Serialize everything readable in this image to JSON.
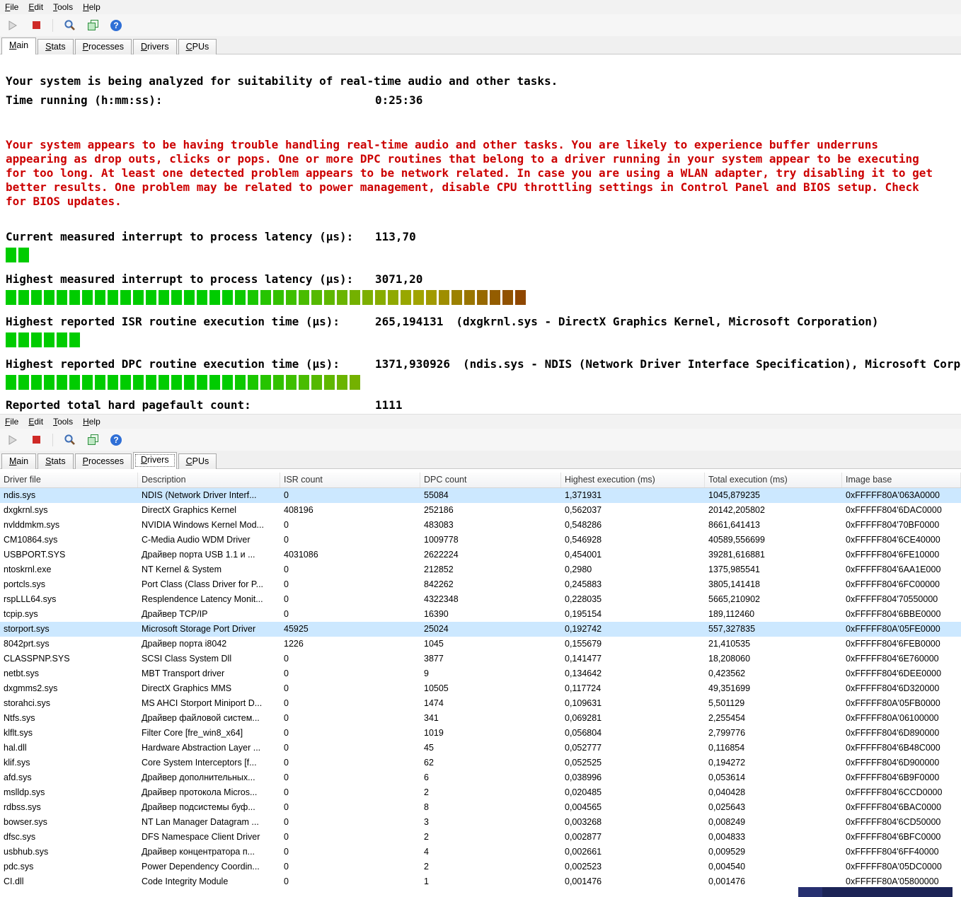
{
  "colors": {
    "warning_text": "#cc0000",
    "selection_row": "#cce8ff",
    "meter_green": "#00cc00",
    "meter_brown": "#8f4700",
    "stop_red": "#cf2a27",
    "artifact_navy": "#1c2456"
  },
  "menu": {
    "items": [
      "File",
      "Edit",
      "Tools",
      "Help"
    ]
  },
  "toolbar": {
    "buttons": [
      "play",
      "stop",
      "analyze",
      "report",
      "help"
    ]
  },
  "tabs": [
    "Main",
    "Stats",
    "Processes",
    "Drivers",
    "CPUs"
  ],
  "top_window": {
    "selected_tab": "Main",
    "analysis_line": "Your system is being analyzed for suitability of real-time audio and other tasks.",
    "time_label": "Time running (h:mm:ss):",
    "time_value": "0:25:36",
    "warning_lines": [
      "Your system appears to be having trouble handling real-time audio and other tasks. You are likely to experience buffer underruns",
      "appearing as drop outs, clicks or pops. One or more DPC routines that belong to a driver running in your system appear to be executing",
      "for too long. At least one detected problem appears to be network related. In case you are using a WLAN adapter, try disabling it to get",
      "better results. One problem may be related to power management, disable CPU throttling settings in Control Panel and BIOS setup. Check",
      "for BIOS updates."
    ],
    "meters": [
      {
        "label": "Current measured interrupt to process latency (µs):",
        "value": "113,70",
        "extra": "",
        "segments": 2
      },
      {
        "label": "Highest measured interrupt to process latency (µs):",
        "value": "3071,20",
        "extra": "",
        "segments": 41
      },
      {
        "label": "Highest reported ISR routine execution time (µs):",
        "value": "265,194131",
        "extra": "(dxgkrnl.sys - DirectX Graphics Kernel, Microsoft Corporation)",
        "segments": 6
      },
      {
        "label": "Highest reported DPC routine execution time (µs):",
        "value": "1371,930926",
        "extra": "(ndis.sys - NDIS (Network Driver Interface Specification), Microsoft Corporation)",
        "segments": 28
      }
    ],
    "pagefault_label": "Reported total hard pagefault count:",
    "pagefault_value": "1111"
  },
  "bottom_window": {
    "selected_tab": "Drivers",
    "table": {
      "columns": [
        "Driver file",
        "Description",
        "ISR count",
        "DPC count",
        "Highest execution (ms)",
        "Total execution (ms)",
        "Image base"
      ],
      "selected_row_indexes": [
        0,
        9
      ],
      "rows": [
        [
          "ndis.sys",
          "NDIS (Network Driver Interf...",
          "0",
          "55084",
          "1,371931",
          "1045,879235",
          "0xFFFFF80A'063A0000"
        ],
        [
          "dxgkrnl.sys",
          "DirectX Graphics Kernel",
          "408196",
          "252186",
          "0,562037",
          "20142,205802",
          "0xFFFFF804'6DAC0000"
        ],
        [
          "nvlddmkm.sys",
          "NVIDIA Windows Kernel Mod...",
          "0",
          "483083",
          "0,548286",
          "8661,641413",
          "0xFFFFF804'70BF0000"
        ],
        [
          "CM10864.sys",
          "C-Media Audio WDM Driver",
          "0",
          "1009778",
          "0,546928",
          "40589,556699",
          "0xFFFFF804'6CE40000"
        ],
        [
          "USBPORT.SYS",
          "Драйвер порта USB 1.1 и ...",
          "4031086",
          "2622224",
          "0,454001",
          "39281,616881",
          "0xFFFFF804'6FE10000"
        ],
        [
          "ntoskrnl.exe",
          "NT Kernel & System",
          "0",
          "212852",
          "0,2980",
          "1375,985541",
          "0xFFFFF804'6AA1E000"
        ],
        [
          "portcls.sys",
          "Port Class (Class Driver for P...",
          "0",
          "842262",
          "0,245883",
          "3805,141418",
          "0xFFFFF804'6FC00000"
        ],
        [
          "rspLLL64.sys",
          "Resplendence Latency Monit...",
          "0",
          "4322348",
          "0,228035",
          "5665,210902",
          "0xFFFFF804'70550000"
        ],
        [
          "tcpip.sys",
          "Драйвер TCP/IP",
          "0",
          "16390",
          "0,195154",
          "189,112460",
          "0xFFFFF804'6BBE0000"
        ],
        [
          "storport.sys",
          "Microsoft Storage Port Driver",
          "45925",
          "25024",
          "0,192742",
          "557,327835",
          "0xFFFFF80A'05FE0000"
        ],
        [
          "8042prt.sys",
          "Драйвер порта i8042",
          "1226",
          "1045",
          "0,155679",
          "21,410535",
          "0xFFFFF804'6FEB0000"
        ],
        [
          "CLASSPNP.SYS",
          "SCSI Class System Dll",
          "0",
          "3877",
          "0,141477",
          "18,208060",
          "0xFFFFF804'6E760000"
        ],
        [
          "netbt.sys",
          "MBT Transport driver",
          "0",
          "9",
          "0,134642",
          "0,423562",
          "0xFFFFF804'6DEE0000"
        ],
        [
          "dxgmms2.sys",
          "DirectX Graphics MMS",
          "0",
          "10505",
          "0,117724",
          "49,351699",
          "0xFFFFF804'6D320000"
        ],
        [
          "storahci.sys",
          "MS AHCI Storport Miniport D...",
          "0",
          "1474",
          "0,109631",
          "5,501129",
          "0xFFFFF80A'05FB0000"
        ],
        [
          "Ntfs.sys",
          "Драйвер файловой систем...",
          "0",
          "341",
          "0,069281",
          "2,255454",
          "0xFFFFF80A'06100000"
        ],
        [
          "klflt.sys",
          "Filter Core [fre_win8_x64]",
          "0",
          "1019",
          "0,056804",
          "2,799776",
          "0xFFFFF804'6D890000"
        ],
        [
          "hal.dll",
          "Hardware Abstraction Layer ...",
          "0",
          "45",
          "0,052777",
          "0,116854",
          "0xFFFFF804'6B48C000"
        ],
        [
          "klif.sys",
          "Core System Interceptors [f...",
          "0",
          "62",
          "0,052525",
          "0,194272",
          "0xFFFFF804'6D900000"
        ],
        [
          "afd.sys",
          "Драйвер дополнительных...",
          "0",
          "6",
          "0,038996",
          "0,053614",
          "0xFFFFF804'6B9F0000"
        ],
        [
          "mslldp.sys",
          "Драйвер протокола Micros...",
          "0",
          "2",
          "0,020485",
          "0,040428",
          "0xFFFFF804'6CCD0000"
        ],
        [
          "rdbss.sys",
          "Драйвер подсистемы буф...",
          "0",
          "8",
          "0,004565",
          "0,025643",
          "0xFFFFF804'6BAC0000"
        ],
        [
          "bowser.sys",
          "NT Lan Manager Datagram ...",
          "0",
          "3",
          "0,003268",
          "0,008249",
          "0xFFFFF804'6CD50000"
        ],
        [
          "dfsc.sys",
          "DFS Namespace Client Driver",
          "0",
          "2",
          "0,002877",
          "0,004833",
          "0xFFFFF804'6BFC0000"
        ],
        [
          "usbhub.sys",
          "Драйвер концентратора п...",
          "0",
          "4",
          "0,002661",
          "0,009529",
          "0xFFFFF804'6FF40000"
        ],
        [
          "pdc.sys",
          "Power Dependency Coordin...",
          "0",
          "2",
          "0,002523",
          "0,004540",
          "0xFFFFF80A'05DC0000"
        ],
        [
          "CI.dll",
          "Code Integrity Module",
          "0",
          "1",
          "0,001476",
          "0,001476",
          "0xFFFFF80A'05800000"
        ]
      ]
    }
  }
}
